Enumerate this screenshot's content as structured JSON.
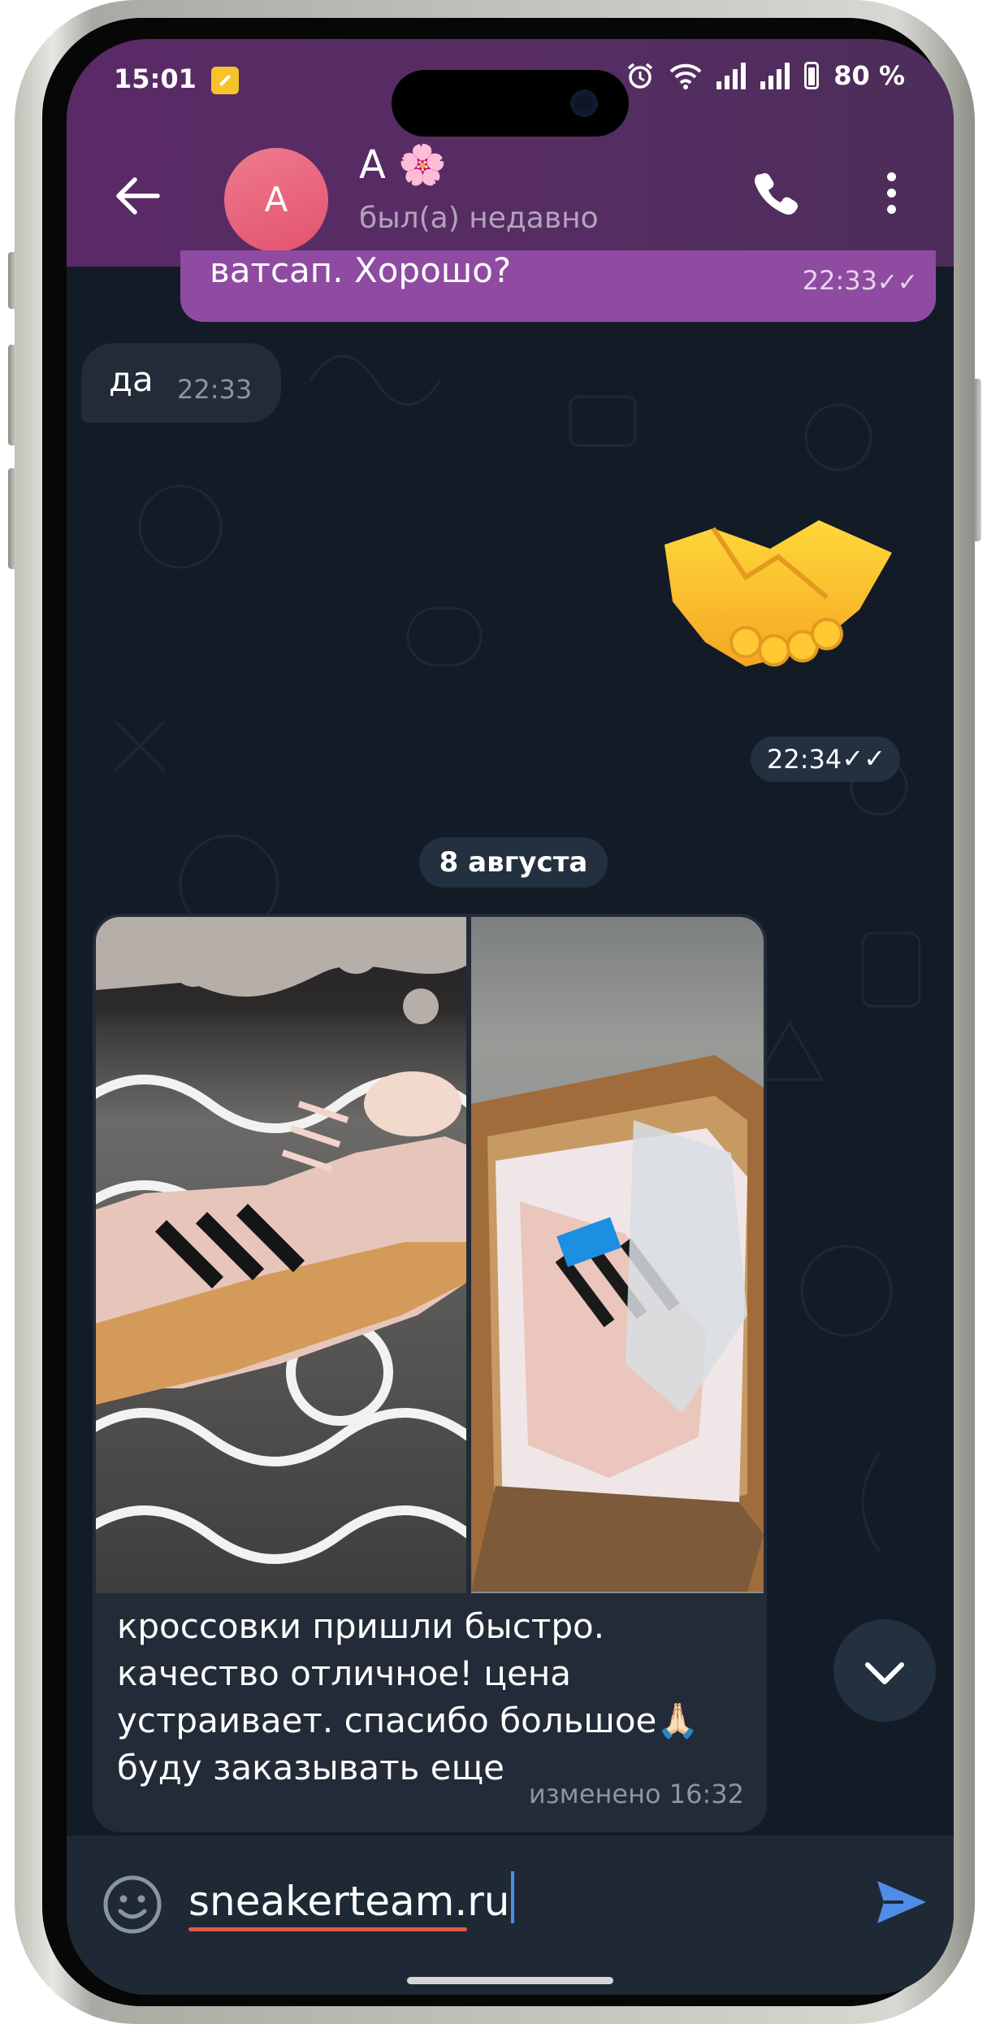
{
  "status_bar": {
    "time": "15:01",
    "battery": "80 %"
  },
  "header": {
    "back_icon": "arrow-left-icon",
    "avatar_letter": "A",
    "contact_name": "A 🌸",
    "contact_status": "был(а) недавно",
    "call_icon": "phone-icon",
    "menu_icon": "more-vertical-icon"
  },
  "messages": [
    {
      "direction": "out",
      "text": "ватсап. Хорошо?",
      "time": "22:33",
      "read": true
    },
    {
      "direction": "in",
      "text": "да",
      "time": "22:33"
    },
    {
      "direction": "out",
      "sticker": "handshake-emoji",
      "time": "22:34",
      "read": true
    }
  ],
  "date_separator": "8 августа",
  "photo_message": {
    "direction": "in",
    "photos": [
      "sneakers-on-rug-photo",
      "sneakers-in-box-photo"
    ],
    "caption_lines": [
      "кроссовки пришли быстро.",
      "качество отличное! цена",
      "устраивает. спасибо большое🙏🏻",
      "буду заказывать еще"
    ],
    "edited_label": "изменено 16:32"
  },
  "input": {
    "value": "sneakerteam.ru",
    "emoji_icon": "smiley-icon",
    "send_icon": "send-icon"
  },
  "colors": {
    "header": "#572c63",
    "outgoing_bubble": "#8e4ba1",
    "incoming_bubble": "#222b37",
    "chat_bg": "#131b27",
    "accent": "#4e8ee8"
  }
}
